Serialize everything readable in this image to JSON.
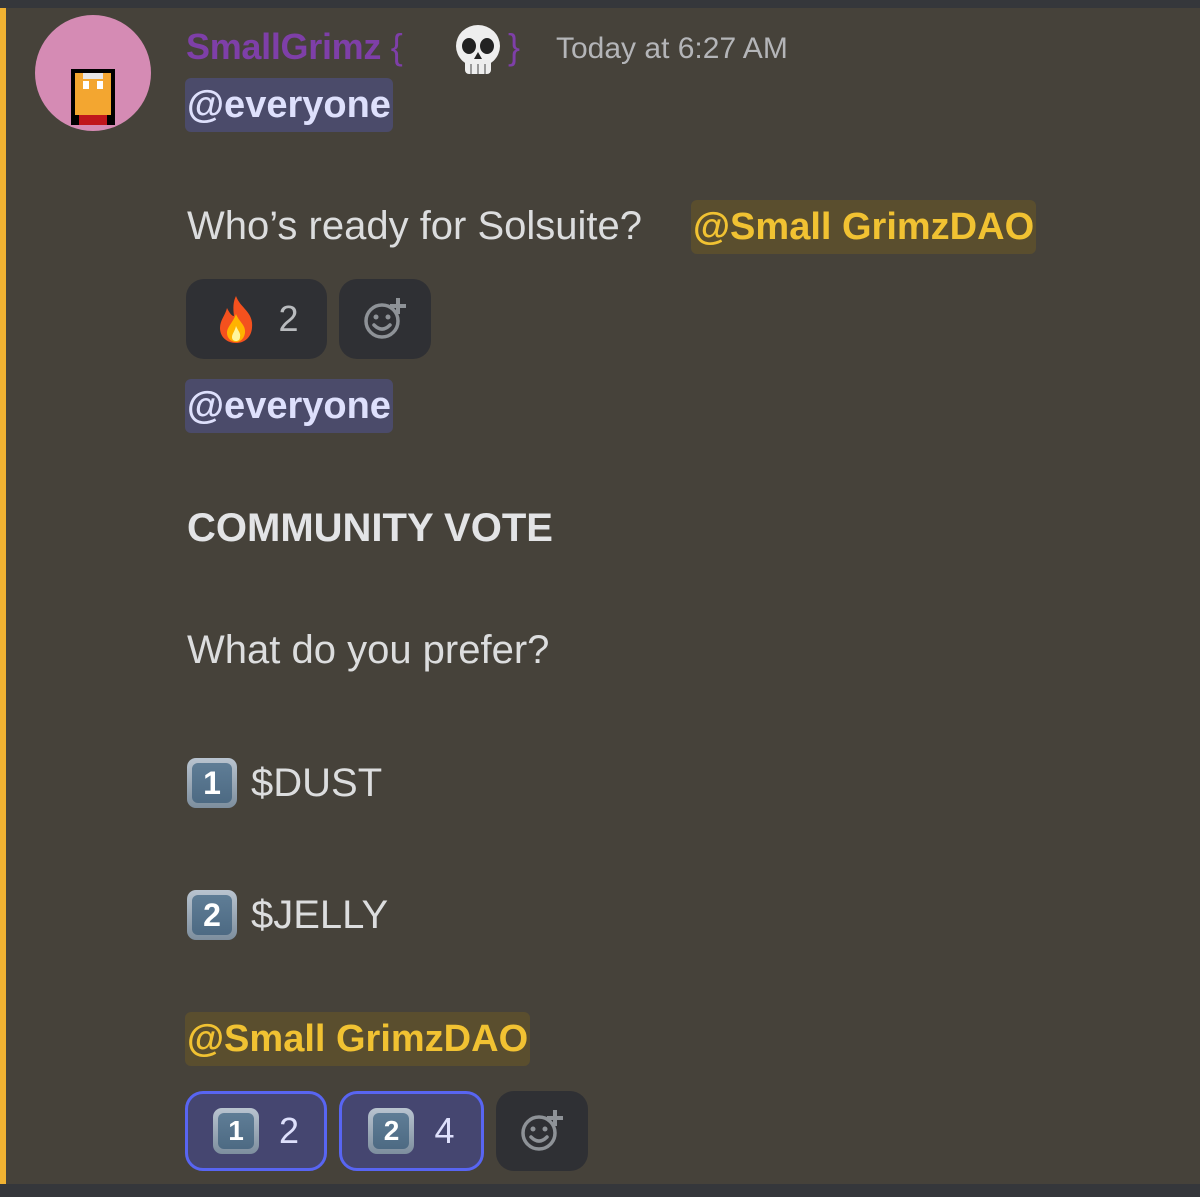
{
  "message": {
    "author": "SmallGrimz",
    "author_suffix_open": "{",
    "author_suffix_close": "}",
    "author_badge_icon": "skull-icon",
    "timestamp": "Today at 6:27 AM",
    "colors": {
      "author": "#7e3fa8",
      "accent": "#f0b232",
      "mention_everyone_bg": "#4b4b6a",
      "mention_role_text": "#f1c232",
      "reaction_selected_border": "#5865f2"
    },
    "first": {
      "mention": "@everyone",
      "text": "Who’s ready for Solsuite?",
      "role_mention": "@Small GrimzDAO",
      "reactions": [
        {
          "emoji": "fire-icon",
          "count": "2"
        }
      ],
      "add_reaction_icon": "add-reaction-icon"
    },
    "second": {
      "mention": "@everyone",
      "heading": "COMMUNITY VOTE",
      "question": "What do you prefer?",
      "options": [
        {
          "key": "1",
          "label": "$DUST"
        },
        {
          "key": "2",
          "label": "$JELLY"
        }
      ],
      "role_mention": "@Small GrimzDAO",
      "reactions": [
        {
          "emoji": "keycap-1",
          "key": "1",
          "count": "2"
        },
        {
          "emoji": "keycap-2",
          "key": "2",
          "count": "4"
        }
      ],
      "add_reaction_icon": "add-reaction-icon"
    }
  }
}
